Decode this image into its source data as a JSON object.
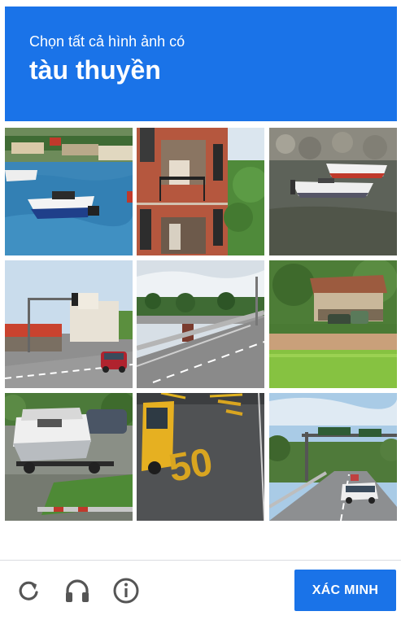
{
  "header": {
    "prompt": "Chọn tất cả hình ảnh có",
    "target": "tàu thuyền",
    "background_color": "#1a73e8"
  },
  "grid": {
    "tiles": [
      {
        "subject": "boats-in-harbor"
      },
      {
        "subject": "brick-building-balcony"
      },
      {
        "subject": "boats-on-shore"
      },
      {
        "subject": "street-traffic-light"
      },
      {
        "subject": "highway-overpass"
      },
      {
        "subject": "farmhouse-field"
      },
      {
        "subject": "boat-on-trailer"
      },
      {
        "subject": "road-marking-50"
      },
      {
        "subject": "highway-sign-gantry"
      }
    ],
    "road_marking_text": "50"
  },
  "footer": {
    "icons": [
      "reload-icon",
      "headphones-icon",
      "info-icon"
    ],
    "verify_label": "XÁC MINH",
    "accent_color": "#1a73e8"
  }
}
